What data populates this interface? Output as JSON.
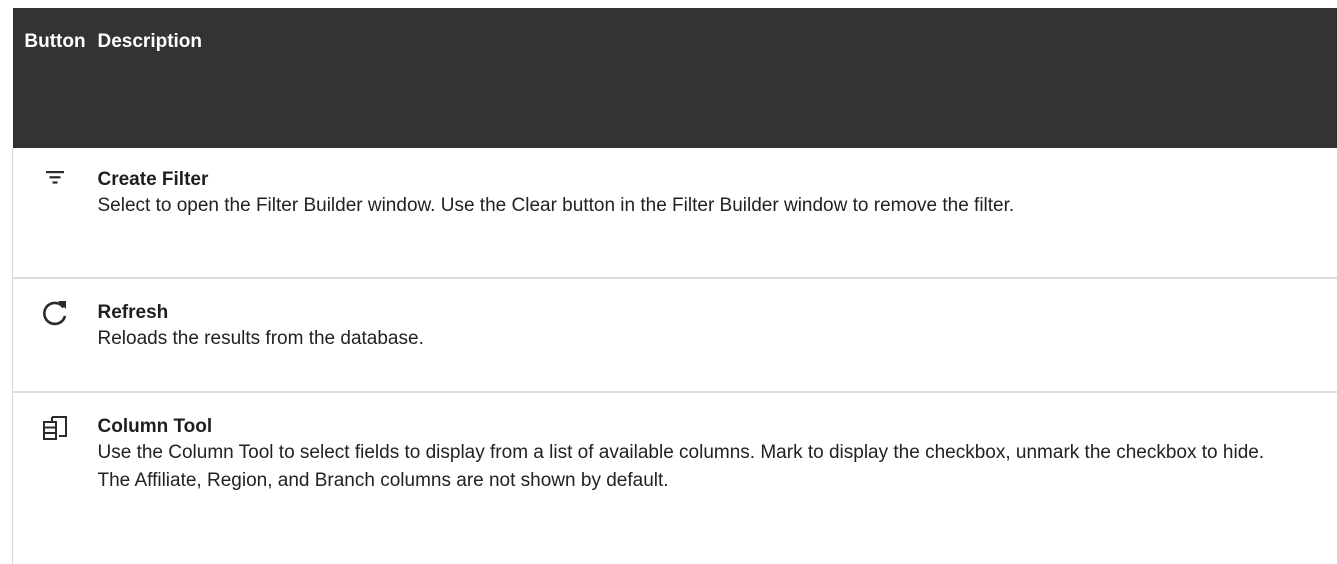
{
  "table": {
    "headers": {
      "button": "Button",
      "description": "Description"
    },
    "rows": [
      {
        "icon": "filter-icon",
        "title": "Create Filter",
        "text": "Select to open the Filter Builder window. Use the Clear button in the Filter Builder window to remove the filter."
      },
      {
        "icon": "refresh-icon",
        "title": "Refresh",
        "text": "Reloads the results from the database."
      },
      {
        "icon": "column-tool-icon",
        "title": "Column Tool",
        "text": "Use the Column Tool to select fields to display from a list of available columns. Mark to display the checkbox, unmark the checkbox to hide. The Affiliate, Region, and Branch columns are not shown by default."
      }
    ]
  },
  "colors": {
    "header_background": "#333333",
    "header_text": "#ffffff",
    "row_divider": "#dcdcdc"
  }
}
